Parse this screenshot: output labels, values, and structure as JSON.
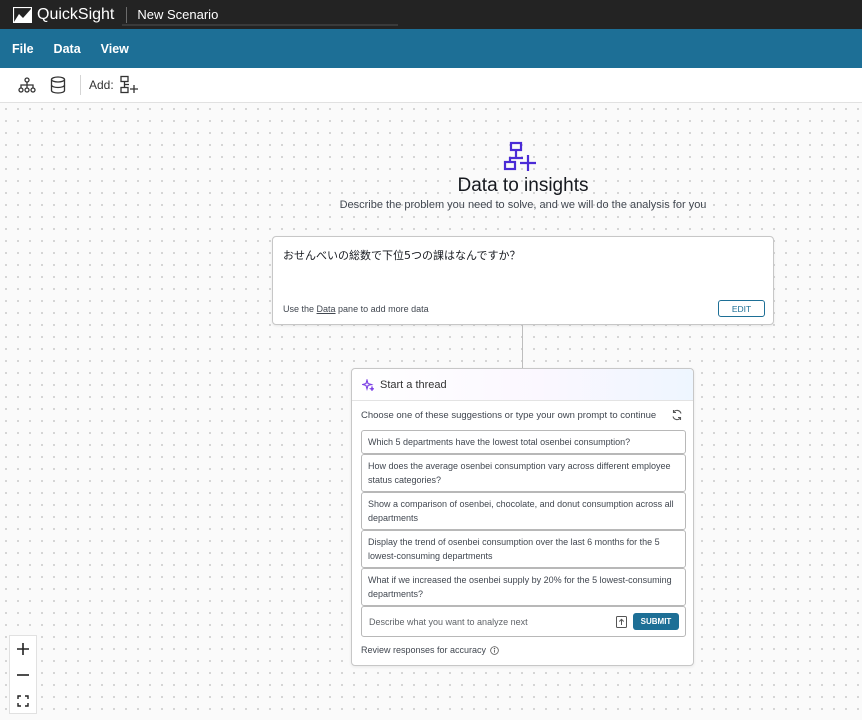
{
  "app": {
    "name": "QuickSight",
    "scenario_title": "New Scenario"
  },
  "menu": {
    "items": [
      "File",
      "Data",
      "View"
    ]
  },
  "toolbar": {
    "add_label": "Add:"
  },
  "hero": {
    "title": "Data to insights",
    "subtitle": "Describe the problem you need to solve, and we will do the analysis for you"
  },
  "prompt_card": {
    "text": "おせんべいの総数で下位5つの課はなんですか？",
    "hint_prefix": "Use the ",
    "hint_link": "Data",
    "hint_suffix": " pane to add more data",
    "edit_label": "EDIT"
  },
  "thread": {
    "title": "Start a thread",
    "suggest_label": "Choose one of these suggestions or type your own prompt to continue",
    "suggestions": [
      "Which 5 departments have the lowest total osenbei consumption?",
      "How does the average osenbei consumption vary across different employee status categories?",
      "Show a comparison of osenbei, chocolate, and donut consumption across all departments",
      "Display the trend of osenbei consumption over the last 6 months for the 5 lowest-consuming departments",
      "What if we increased the osenbei supply by 20% for the 5 lowest-consuming departments?"
    ],
    "ask_placeholder": "Describe what you want to analyze next",
    "submit_label": "SUBMIT",
    "review_text": "Review responses for accuracy"
  },
  "colors": {
    "topbar": "#232323",
    "menubar": "#1d6f96",
    "accent": "#1d6f96",
    "hero_icon": "#4a2bd6"
  }
}
